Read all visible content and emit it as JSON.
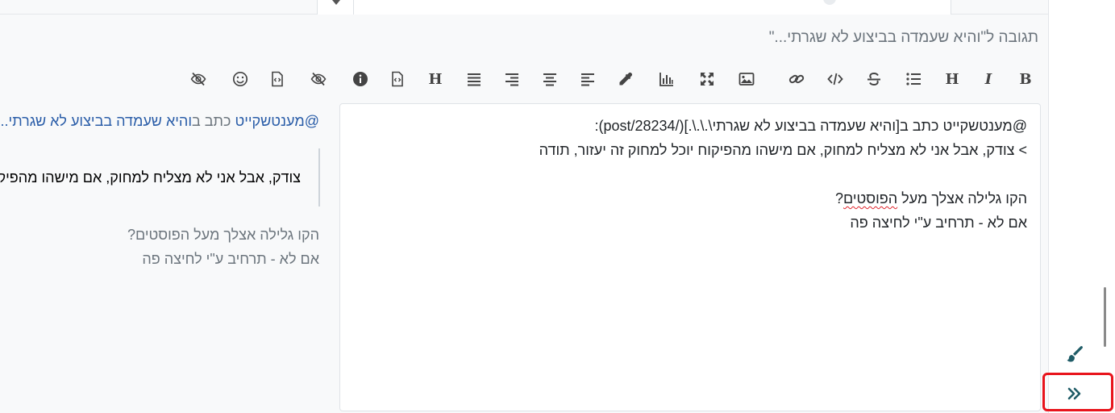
{
  "reply_title": "תגובה ל\"והיא שעמדה בביצוע לא שגרתי...\"",
  "toolbar": {
    "buttons": [
      {
        "name": "bold-icon",
        "label": "B"
      },
      {
        "name": "italic-icon",
        "label": "I"
      },
      {
        "name": "heading-icon",
        "label": "H"
      },
      {
        "name": "bullet-list-icon",
        "label": ""
      },
      {
        "name": "strikethrough-icon",
        "label": ""
      },
      {
        "name": "code-icon",
        "label": ""
      },
      {
        "name": "link-icon",
        "label": ""
      },
      {
        "name": "image-icon",
        "label": ""
      },
      {
        "name": "fullscreen-icon",
        "label": ""
      },
      {
        "name": "chart-icon",
        "label": ""
      },
      {
        "name": "color-picker-icon",
        "label": ""
      },
      {
        "name": "align-left-icon",
        "label": ""
      },
      {
        "name": "align-center-icon",
        "label": ""
      },
      {
        "name": "align-right-icon",
        "label": ""
      },
      {
        "name": "align-justify-icon",
        "label": ""
      },
      {
        "name": "heading-alt-icon",
        "label": "H"
      },
      {
        "name": "code-file-icon",
        "label": ""
      },
      {
        "name": "info-icon",
        "label": ""
      },
      {
        "name": "spoiler-icon",
        "label": ""
      },
      {
        "name": "file-code-icon",
        "label": ""
      },
      {
        "name": "emoji-icon",
        "label": ""
      },
      {
        "name": "hide-icon",
        "label": ""
      }
    ]
  },
  "editor": {
    "line1": "@מענטשקייט כתב ב[והיא שעמדה בביצוע לא שגרתי\\.\\.\\.](/post/28234):",
    "line2": "> צודק, אבל אני לא מצליח למחוק, אם מישהו מהפיקוח יוכל למחוק זה יעזור, תודה",
    "line4_pre": "הקו גלילה אצלך מעל ",
    "line4_misspelled": "הפוסטים",
    "line4_post": "?",
    "line5": "אם לא - תרחיב ע\"י לחיצה פה"
  },
  "preview": {
    "mention": "@מענטשקייט",
    "wrote": " כתב ב",
    "link_text": "והיא שעמדה בביצוע לא שגרתי...",
    "quote": "צודק, אבל אני לא מצליח למחוק, אם מישהו מהפיקוח יוכל למחוק זה יעזור, תודה",
    "line1": "הקו גלילה אצלך מעל הפוסטים?",
    "line2": "אם לא - תרחיב ע\"י לחיצה פה"
  },
  "colors": {
    "accent": "#1f5c67",
    "link": "#2a5da8",
    "annotation": "#e8141c"
  }
}
